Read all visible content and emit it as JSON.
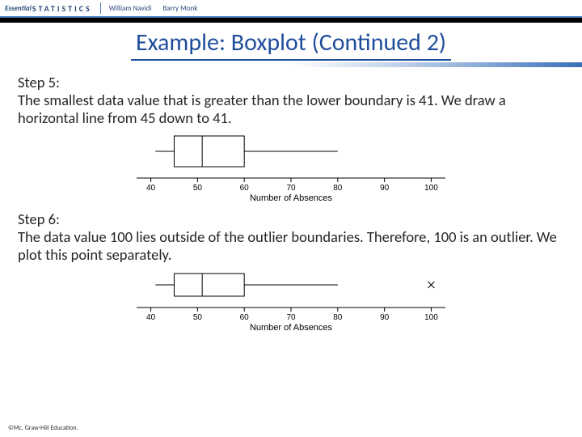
{
  "banner": {
    "brand_essential": "Essential",
    "brand_stats": "STATISTICS",
    "author1": "William Navidi",
    "author2": "Barry Monk"
  },
  "title": "Example: Boxplot (Continued 2)",
  "step5": {
    "label": "Step 5:",
    "text": "The smallest data value that is greater than the lower boundary is 41. We draw a horizontal line from 45 down to 41."
  },
  "step6": {
    "label": "Step 6:",
    "text": "The data value 100 lies outside of the outlier boundaries. Therefore, 100 is an outlier. We plot this point separately."
  },
  "axis_label": "Number of Absences",
  "ticks": [
    "40",
    "50",
    "60",
    "70",
    "80",
    "90",
    "100"
  ],
  "footer": "©Mc. Graw-Hill Education.",
  "chart_data": [
    {
      "type": "boxplot",
      "title": "",
      "xlabel": "Number of Absences",
      "xlim": [
        38,
        102
      ],
      "xticks": [
        40,
        50,
        60,
        70,
        80,
        90,
        100
      ],
      "whisker_low": 41,
      "q1": 45,
      "median": 51,
      "q3": 60,
      "whisker_high": 80,
      "outliers": []
    },
    {
      "type": "boxplot",
      "title": "",
      "xlabel": "Number of Absences",
      "xlim": [
        38,
        102
      ],
      "xticks": [
        40,
        50,
        60,
        70,
        80,
        90,
        100
      ],
      "whisker_low": 41,
      "q1": 45,
      "median": 51,
      "q3": 60,
      "whisker_high": 80,
      "outliers": [
        100
      ]
    }
  ]
}
